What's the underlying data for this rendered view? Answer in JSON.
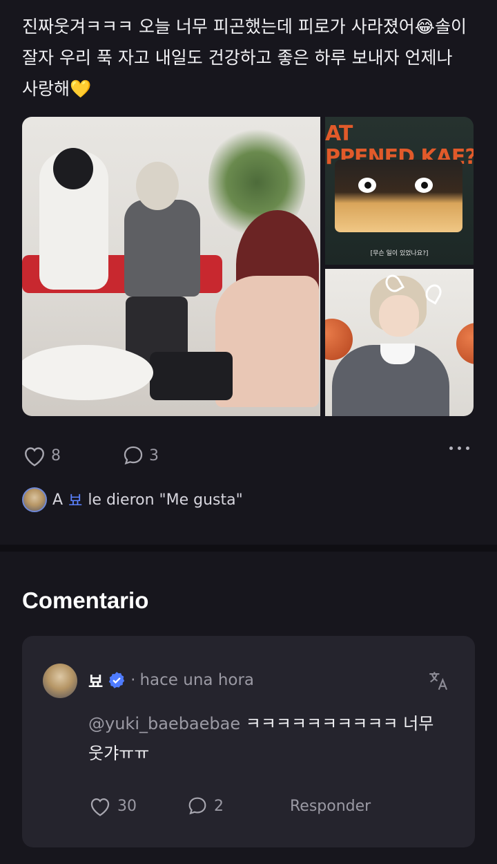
{
  "post": {
    "text": "진짜웃겨ㅋㅋㅋ 오늘 너무 피곤했는데 피로가 사라졌어😂솔이 잘자 우리 푹 자고 내일도 건강하고 좋은 하루 보내자 언제나 사랑해💛",
    "media": {
      "top_right_headline": "AT\nPPENED KAE?",
      "top_right_caption": "[무슨 일이 있었나요?]"
    },
    "actions": {
      "likes": "8",
      "comments": "3"
    },
    "liked_by": {
      "prefix": "A",
      "name": "뵤",
      "suffix": "le dieron \"Me gusta\""
    }
  },
  "comments_section": {
    "title": "Comentario",
    "comment": {
      "user": "뵤",
      "separator": "·",
      "time": "hace una hora",
      "mention": "@yuki_baebaebae",
      "text": " ㅋㅋㅋㅋㅋㅋㅋㅋㅋㅋ 너무 웃갸ㅠㅠ",
      "likes": "30",
      "replies": "2",
      "reply_label": "Responder"
    }
  },
  "colors": {
    "background": "#17161d",
    "card": "#25242d",
    "accent": "#5b82ff",
    "muted": "#9b9aa4"
  }
}
